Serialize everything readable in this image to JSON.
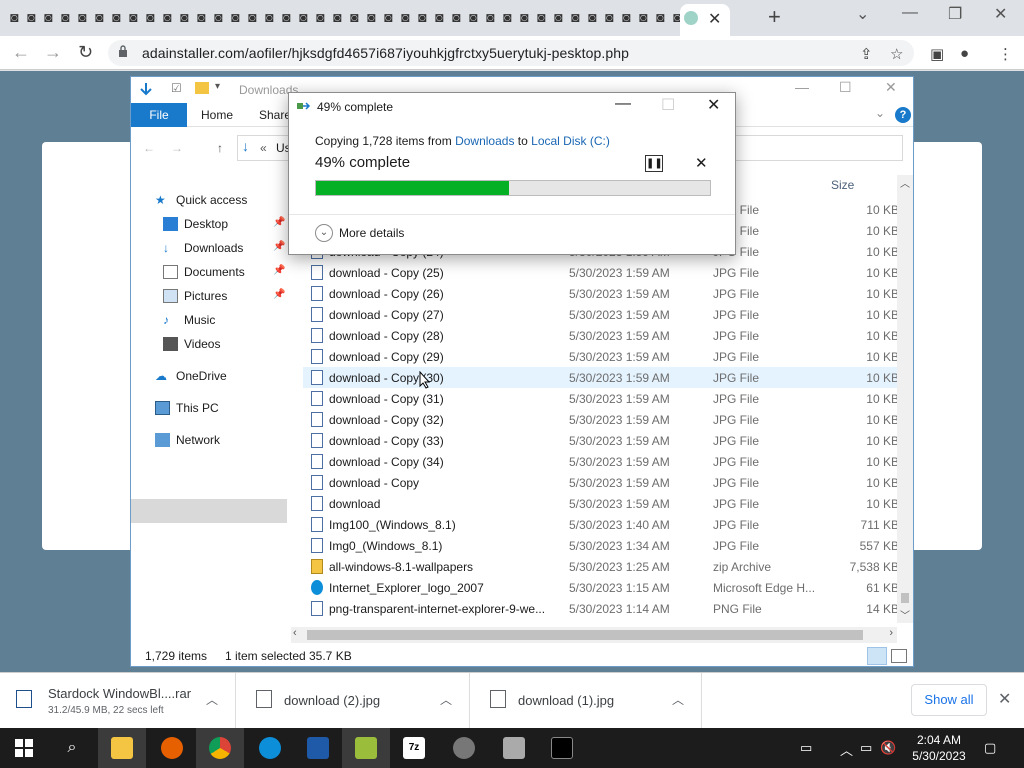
{
  "browser": {
    "active_tab_close": "✕",
    "new_tab": "+",
    "url": "adainstaller.com/aofiler/hjksdgfd4657i687iyouhkjgfrctxy5uerytukj-pesktop.php"
  },
  "explorer": {
    "title": "Downloads",
    "ribbon_tabs": [
      "File",
      "Home",
      "Share"
    ],
    "address_partial": "Us",
    "column_size": "Size",
    "nav": {
      "quick_access": "Quick access",
      "desktop": "Desktop",
      "downloads": "Downloads",
      "documents": "Documents",
      "pictures": "Pictures",
      "music": "Music",
      "videos": "Videos",
      "onedrive": "OneDrive",
      "this_pc": "This PC",
      "network": "Network"
    },
    "files": [
      {
        "name": "",
        "date": "",
        "type": "JPG File",
        "size": "10 KB"
      },
      {
        "name": "",
        "date": "",
        "type": "JPG File",
        "size": "10 KB"
      },
      {
        "name": "download - Copy (24)",
        "date": "5/30/2023 1:59 AM",
        "type": "JPG File",
        "size": "10 KB"
      },
      {
        "name": "download - Copy (25)",
        "date": "5/30/2023 1:59 AM",
        "type": "JPG File",
        "size": "10 KB"
      },
      {
        "name": "download - Copy (26)",
        "date": "5/30/2023 1:59 AM",
        "type": "JPG File",
        "size": "10 KB"
      },
      {
        "name": "download - Copy (27)",
        "date": "5/30/2023 1:59 AM",
        "type": "JPG File",
        "size": "10 KB"
      },
      {
        "name": "download - Copy (28)",
        "date": "5/30/2023 1:59 AM",
        "type": "JPG File",
        "size": "10 KB"
      },
      {
        "name": "download - Copy (29)",
        "date": "5/30/2023 1:59 AM",
        "type": "JPG File",
        "size": "10 KB"
      },
      {
        "name": "download - Copy (30)",
        "date": "5/30/2023 1:59 AM",
        "type": "JPG File",
        "size": "10 KB"
      },
      {
        "name": "download - Copy (31)",
        "date": "5/30/2023 1:59 AM",
        "type": "JPG File",
        "size": "10 KB"
      },
      {
        "name": "download - Copy (32)",
        "date": "5/30/2023 1:59 AM",
        "type": "JPG File",
        "size": "10 KB"
      },
      {
        "name": "download - Copy (33)",
        "date": "5/30/2023 1:59 AM",
        "type": "JPG File",
        "size": "10 KB"
      },
      {
        "name": "download - Copy (34)",
        "date": "5/30/2023 1:59 AM",
        "type": "JPG File",
        "size": "10 KB"
      },
      {
        "name": "download - Copy",
        "date": "5/30/2023 1:59 AM",
        "type": "JPG File",
        "size": "10 KB"
      },
      {
        "name": "download",
        "date": "5/30/2023 1:59 AM",
        "type": "JPG File",
        "size": "10 KB"
      },
      {
        "name": "Img100_(Windows_8.1)",
        "date": "5/30/2023 1:40 AM",
        "type": "JPG File",
        "size": "711 KB"
      },
      {
        "name": "Img0_(Windows_8.1)",
        "date": "5/30/2023 1:34 AM",
        "type": "JPG File",
        "size": "557 KB"
      },
      {
        "name": "all-windows-8.1-wallpapers",
        "date": "5/30/2023 1:25 AM",
        "type": "zip Archive",
        "size": "7,538 KB"
      },
      {
        "name": "Internet_Explorer_logo_2007",
        "date": "5/30/2023 1:15 AM",
        "type": "Microsoft Edge H...",
        "size": "61 KB"
      },
      {
        "name": "png-transparent-internet-explorer-9-we...",
        "date": "5/30/2023 1:14 AM",
        "type": "PNG File",
        "size": "14 KB"
      }
    ],
    "status": {
      "items": "1,729 items",
      "selected": "1 item selected",
      "sel_size": "35.7 KB"
    }
  },
  "copy_dialog": {
    "title": "49% complete",
    "copying_prefix": "Copying 1,728 items from",
    "source": "Downloads",
    "to": "to",
    "destination": "Local Disk (C:)",
    "percent_label": "49% complete",
    "progress": 0.49,
    "more_details": "More details",
    "progress_color": "#06b025"
  },
  "download_bar": {
    "items": [
      {
        "name": "Stardock WindowBl....rar",
        "sub": "31.2/45.9 MB, 22 secs left"
      },
      {
        "name": "download (2).jpg",
        "sub": ""
      },
      {
        "name": "download (1).jpg",
        "sub": ""
      }
    ],
    "show_all": "Show all"
  },
  "taskbar": {
    "time": "2:04 AM",
    "date": "5/30/2023"
  }
}
